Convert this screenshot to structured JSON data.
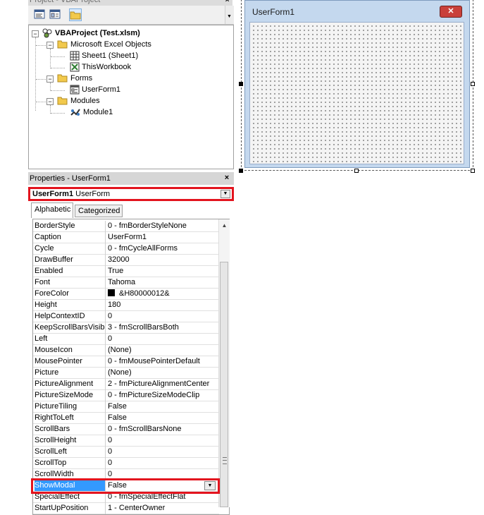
{
  "project": {
    "title": "Project - VBAProject",
    "close_label": "×",
    "toolbar": [
      {
        "name": "view-code-button",
        "icon": "view-code-icon"
      },
      {
        "name": "view-object-button",
        "icon": "view-object-icon"
      },
      {
        "name": "toggle-folders-button",
        "icon": "folder-icon"
      }
    ],
    "tree": {
      "root": "VBAProject (Test.xlsm)",
      "excel_objects": "Microsoft Excel Objects",
      "sheet1": "Sheet1 (Sheet1)",
      "thisworkbook": "ThisWorkbook",
      "forms": "Forms",
      "userform1": "UserForm1",
      "modules": "Modules",
      "module1": "Module1"
    }
  },
  "properties": {
    "title": "Properties - UserForm1",
    "close_label": "×",
    "object_name": "UserForm1",
    "object_type": "UserForm",
    "tabs": {
      "alphabetic": "Alphabetic",
      "categorized": "Categorized"
    },
    "rows": [
      {
        "name": "BorderStyle",
        "value": "0 - fmBorderStyleNone"
      },
      {
        "name": "Caption",
        "value": "UserForm1"
      },
      {
        "name": "Cycle",
        "value": "0 - fmCycleAllForms"
      },
      {
        "name": "DrawBuffer",
        "value": "32000"
      },
      {
        "name": "Enabled",
        "value": "True"
      },
      {
        "name": "Font",
        "value": "Tahoma"
      },
      {
        "name": "ForeColor",
        "value": "&H80000012&"
      },
      {
        "name": "Height",
        "value": "180"
      },
      {
        "name": "HelpContextID",
        "value": "0"
      },
      {
        "name": "KeepScrollBarsVisible",
        "value": "3 - fmScrollBarsBoth"
      },
      {
        "name": "Left",
        "value": "0"
      },
      {
        "name": "MouseIcon",
        "value": "(None)"
      },
      {
        "name": "MousePointer",
        "value": "0 - fmMousePointerDefault"
      },
      {
        "name": "Picture",
        "value": "(None)"
      },
      {
        "name": "PictureAlignment",
        "value": "2 - fmPictureAlignmentCenter"
      },
      {
        "name": "PictureSizeMode",
        "value": "0 - fmPictureSizeModeClip"
      },
      {
        "name": "PictureTiling",
        "value": "False"
      },
      {
        "name": "RightToLeft",
        "value": "False"
      },
      {
        "name": "ScrollBars",
        "value": "0 - fmScrollBarsNone"
      },
      {
        "name": "ScrollHeight",
        "value": "0"
      },
      {
        "name": "ScrollLeft",
        "value": "0"
      },
      {
        "name": "ScrollTop",
        "value": "0"
      },
      {
        "name": "ScrollWidth",
        "value": "0"
      },
      {
        "name": "ShowModal",
        "value": "False"
      },
      {
        "name": "SpecialEffect",
        "value": "0 - fmSpecialEffectFlat"
      },
      {
        "name": "StartUpPosition",
        "value": "1 - CenterOwner"
      }
    ],
    "selected_row": "ShowModal",
    "forecolor_swatch": "#000000"
  },
  "designer": {
    "form_caption": "UserForm1",
    "close_label": "✕"
  },
  "colors": {
    "highlight_red": "#e3141e",
    "selection_blue": "#3399ff",
    "form_frame": "#c4d8ee",
    "close_red": "#c9403a"
  }
}
